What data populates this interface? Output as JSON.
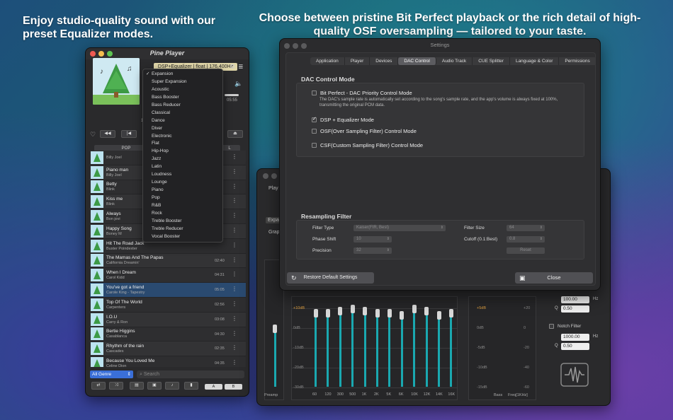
{
  "headlines": {
    "left": "Enjoy studio-quality sound with our preset Equalizer modes.",
    "right": "Choose between pristine Bit Perfect playback or the rich detail of high-quality OSF oversampling — tailored to your taste."
  },
  "player": {
    "title": "Pine Player",
    "mode_label": "DSP+Equalizer | float | 176,400Hz",
    "time_right": "05:55",
    "time_left": "18",
    "tab_pop": "POP",
    "tab_other": "L",
    "songs": [
      {
        "title": "",
        "artist": "Billy Joel",
        "duration": ""
      },
      {
        "title": "Piano man",
        "artist": "Billy Joel",
        "duration": ""
      },
      {
        "title": "Betty",
        "artist": "Blink",
        "duration": ""
      },
      {
        "title": "Kiss me",
        "artist": "Blink",
        "duration": ""
      },
      {
        "title": "Always",
        "artist": "Bon jovi",
        "duration": ""
      },
      {
        "title": "Happy Song",
        "artist": "Boney M",
        "duration": ""
      },
      {
        "title": "Hit The Road Jack",
        "artist": "Buster Poindexter",
        "duration": ""
      },
      {
        "title": "The Mamas And The Papas",
        "artist": "California Dreamin'",
        "duration": "02:40"
      },
      {
        "title": "When I Dream",
        "artist": "Carol Kidd",
        "duration": "04:31"
      },
      {
        "title": "You've got a friend",
        "artist": "Carole King - Tapestry",
        "duration": "05:05"
      },
      {
        "title": "Top Of The World",
        "artist": "Carpenters",
        "duration": "02:56"
      },
      {
        "title": "I.O.U",
        "artist": "Carry & Ron",
        "duration": "03:08"
      },
      {
        "title": "Bertie Higgins",
        "artist": "Casablanca",
        "duration": "04:30"
      },
      {
        "title": "Rhythm of the rain",
        "artist": "Cascades",
        "duration": "02:35"
      },
      {
        "title": "Because You Loved Me",
        "artist": "Celine Dion",
        "duration": "04:35"
      }
    ],
    "selected_index": 9,
    "genre": "All Genre",
    "search_placeholder": "Search",
    "ab_a": "A",
    "ab_b": "B"
  },
  "eq_menu": {
    "items": [
      "Expansion",
      "Super Expansion",
      "Acoustic",
      "Bass Booster",
      "Bass Reducer",
      "Classical",
      "Dance",
      "Diver",
      "Electronic",
      "Flat",
      "Hip-Hop",
      "Jazz",
      "Latin",
      "Loudness",
      "Lounge",
      "Piano",
      "Pop",
      "R&B",
      "Rock",
      "Treble Booster",
      "Treble Reducer",
      "Vocal Booster"
    ],
    "checked_index": 0
  },
  "eq_window": {
    "label_play": "Play",
    "tab_expa": "Expa",
    "label_grap": "Grap",
    "db_labels": [
      "+10dB",
      "0dB",
      "-10dB",
      "-20dB",
      "-30dB"
    ],
    "bass_db_labels_left": [
      "+5dB",
      "0dB",
      "-5dB",
      "-10dB",
      "-15dB"
    ],
    "bass_db_labels_right": [
      "+20",
      "0",
      "-20",
      "-40",
      "-60"
    ],
    "freqs": [
      "60",
      "120",
      "300",
      "500",
      "1K",
      "2K",
      "5K",
      "6K",
      "10K",
      "12K",
      "14K",
      "16K"
    ],
    "band_values": [
      4,
      4,
      5,
      6,
      5,
      4,
      4,
      3,
      6,
      5,
      3,
      4
    ],
    "preamp_label": "Preamp",
    "bass_label": "Bass",
    "freq_label": "Freq[1KHz]",
    "filter1_freq": "100.00",
    "filter1_q": "0.50",
    "notch_label": "Notch Filter",
    "filter2_freq": "1000.00",
    "filter2_q": "0.50",
    "hz": "Hz",
    "q": "Q"
  },
  "settings": {
    "title": "Settings",
    "tabs": [
      "Application",
      "Player",
      "Devices",
      "DAC Control",
      "Audio Track",
      "CUE Splitter",
      "Language & Color",
      "Permissions"
    ],
    "active_tab": 3,
    "dac_title": "DAC Control Mode",
    "options": [
      {
        "label": "Bit Perfect - DAC Priority Control Mode",
        "checked": false
      },
      {
        "label": "DSP + Equalizer Mode",
        "checked": true
      },
      {
        "label": "OSF(Over Sampling Filter) Control Mode",
        "checked": false
      },
      {
        "label": "CSF(Custom Sampling Filter) Control Mode",
        "checked": false
      }
    ],
    "bitperfect_desc": "The DAC's sample rate is automatically set according to the song's sample rate, and the app's volume is always fixed at 100%, transmitting the original PCM data.",
    "resampling_title": "Resampling Filter",
    "filter_type_label": "Filter Type",
    "filter_type_value": "Kaiser(FIR, Best)",
    "filter_size_label": "Filter Size",
    "filter_size_value": "64",
    "phase_shift_label": "Phase Shift",
    "phase_shift_value": "10",
    "cutoff_label": "Cutoff (0.1:Best)",
    "cutoff_value": "0.8",
    "precision_label": "Precision",
    "precision_value": "32",
    "reset_label": "Reset",
    "restore_label": "Restore Default Settings",
    "close_label": "Close"
  }
}
